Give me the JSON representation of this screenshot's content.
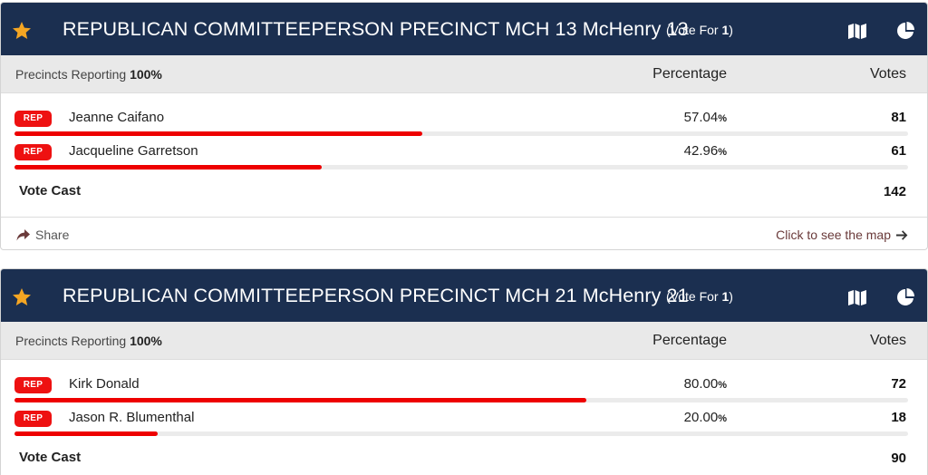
{
  "colors": {
    "header_bg": "#1b2f50",
    "star": "#f5a623",
    "party_badge": "#ee1111",
    "bar_fill": "#ee0000",
    "subhead_bg": "#e9e9e9"
  },
  "icons": {
    "favorite": "star-icon",
    "map": "map-icon",
    "chart": "pie-chart-icon",
    "share": "share-icon",
    "arrow": "arrow-right-icon"
  },
  "labels": {
    "precincts_reporting": "Precincts Reporting",
    "percentage": "Percentage",
    "votes": "Votes",
    "vote_cast": "Vote Cast",
    "share": "Share",
    "see_map": "Click to see the map",
    "vote_for_prefix": "(Vote For",
    "vote_for_suffix": ")",
    "percent_symbol": "%"
  },
  "races": [
    {
      "title": "REPUBLICAN COMMITTEEPERSON PRECINCT MCH 13 McHenry 13",
      "vote_for": "1",
      "precincts_reporting": "100%",
      "candidates": [
        {
          "party": "REP",
          "name": "Jeanne Caifano",
          "percentage": "57.04",
          "pct_value": 57.04,
          "votes": "81"
        },
        {
          "party": "REP",
          "name": "Jacqueline Garretson",
          "percentage": "42.96",
          "pct_value": 42.96,
          "votes": "61"
        }
      ],
      "vote_cast": "142"
    },
    {
      "title": "REPUBLICAN COMMITTEEPERSON PRECINCT MCH 21 McHenry 21",
      "vote_for": "1",
      "precincts_reporting": "100%",
      "candidates": [
        {
          "party": "REP",
          "name": "Kirk Donald",
          "percentage": "80.00",
          "pct_value": 80.0,
          "votes": "72"
        },
        {
          "party": "REP",
          "name": "Jason R. Blumenthal",
          "percentage": "20.00",
          "pct_value": 20.0,
          "votes": "18"
        }
      ],
      "vote_cast": "90"
    }
  ]
}
